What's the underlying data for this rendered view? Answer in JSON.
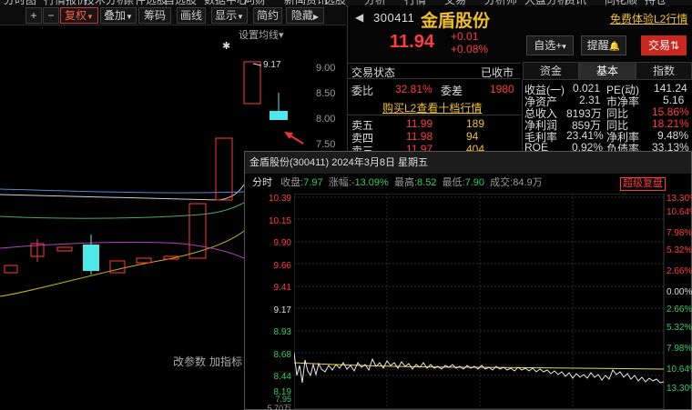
{
  "top_menu": [
    "分时图",
    "行情报价",
    "技术分析",
    "条件选股",
    "自选股",
    "数据中心",
    "问财",
    "新闻资讯",
    "选股",
    "分析",
    "行情",
    "交易",
    "分析师",
    "大盘分析",
    "资讯",
    "同花顺",
    "持仓",
    "分析师荐股"
  ],
  "toolbar": {
    "plus": "+",
    "minus": "−",
    "fuquan": "复权",
    "fuquan_arrow": "▼",
    "diejia": "叠加",
    "diejia_arrow": "▼",
    "chouma": "筹码",
    "huaxian": "画线",
    "xianshi": "显示",
    "xianshi_arrow": "▼",
    "jianyue": "简约",
    "yincang": "隐藏",
    "yincang_arrow": "▶"
  },
  "kline": {
    "setting": "设置均线",
    "setting_arrow": "▾",
    "price_levels": [
      "9.00",
      "8.50",
      "8.00",
      "7.50"
    ],
    "high_label": "9.17",
    "star": "✱",
    "tool_buttons": [
      "改参数",
      "加指标"
    ]
  },
  "stock": {
    "code": "300411",
    "name": "金盾股份",
    "free_l2": "免费体验L2行情",
    "price": "11.94",
    "change": "+0.01",
    "change_pct": "+0.08%",
    "btn_zixuan": "自选",
    "btn_zixuan_plus": "+",
    "btn_zixuan_arrow": "▾",
    "btn_tixing": "提醒",
    "btn_tixing_icon": "🔔",
    "btn_jiaoyi": "交易",
    "btn_jiaoyi_icon": "⇅"
  },
  "status": {
    "label": "交易状态",
    "value": "已收市"
  },
  "tabs": [
    "资金",
    "基本",
    "指数"
  ],
  "order_book": {
    "weibi_label": "委比",
    "weibi": "32.81%",
    "weicha_label": "委差",
    "weicha": "1980",
    "l2_link": "购买L2查看十档行情",
    "asks": [
      {
        "level": "卖五",
        "price": "11.99",
        "vol": "189"
      },
      {
        "level": "卖四",
        "price": "11.98",
        "vol": "94"
      },
      {
        "level": "卖三",
        "price": "11.97",
        "vol": "404"
      }
    ]
  },
  "fundamentals": [
    {
      "k1": "收益(一)",
      "v1": "0.021",
      "k2": "PE(动)",
      "v2": "141.24"
    },
    {
      "k1": "净资产",
      "v1": "2.31",
      "k2": "市净率",
      "v2": "5.16"
    },
    {
      "k1": "总收入",
      "v1": "8193万",
      "k2": "同比",
      "v2": "15.86%"
    },
    {
      "k1": "净利润",
      "v1": "859万",
      "k2": "同比",
      "v2": "18.21%"
    },
    {
      "k1": "毛利率",
      "v1": "23.41%",
      "k2": "净利率",
      "v2": "9.48%"
    },
    {
      "k1": "ROE",
      "v1": "0.92%",
      "k2": "负债率",
      "v2": "33.13%"
    }
  ],
  "popup": {
    "title": "金盾股份(300411) 2024年3月8日 星期五",
    "fenshi": "分时",
    "shoupan_label": "收盘:",
    "shoupan": "7.97",
    "zhangfu_label": "涨幅:",
    "zhangfu": "-13.09%",
    "zuigao_label": "最高:",
    "zuigao": "8.52",
    "zuidi_label": "最低:",
    "zuidi": "7.90",
    "chengjiao_label": "成交:",
    "chengjiao": "84.9万",
    "fuquan_btn": "超级复盘",
    "y_left": [
      "10.39",
      "10.15",
      "9.90",
      "9.66",
      "9.41",
      "9.17",
      "8.93",
      "8.68",
      "8.44",
      "8.19",
      "7.95",
      "7.70",
      "5.70万"
    ],
    "y_right": [
      "13.30%",
      "10.64%",
      "7.98%",
      "5.32%",
      "2.66%",
      "0.00%",
      "2.66%",
      "5.32%",
      "7.98%",
      "10.64%",
      "13.30%"
    ]
  },
  "colors": {
    "up": "#ff3c3c",
    "down": "#33cc66",
    "accent": "#f0c02a",
    "price_line": "#e8e8e8",
    "avg_line": "#e8d64a",
    "ma_yellow": "#c8b400",
    "ma_purple": "#b040c0",
    "ma_white": "#d0d0d0",
    "ma_blue": "#4a8ad8"
  }
}
